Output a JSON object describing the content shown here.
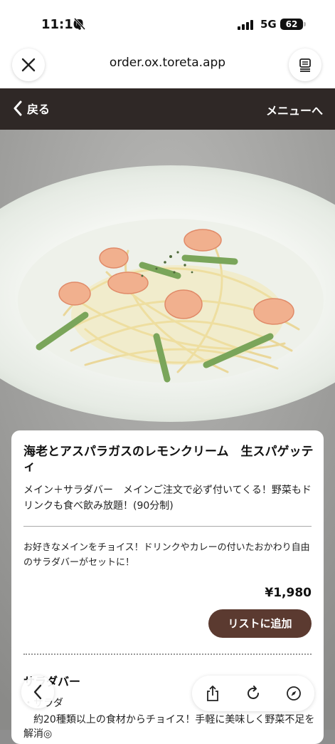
{
  "status_bar": {
    "time": "11:10",
    "network": "5G",
    "battery": "62"
  },
  "browser": {
    "url": "order.ox.toreta.app"
  },
  "nav": {
    "back_label": "戻る",
    "menu_link": "メニューへ"
  },
  "item": {
    "title": "海老とアスパラガスのレモンクリーム　生スパゲッティ",
    "description": "メイン＋サラダバー　メインご注文で必ず付いてくる！野菜もドリンクも食べ飲み放題！(90分制)",
    "details": "お好きなメインをチョイス！ドリンクやカレーの付いたおかわり自由のサラダバーがセットに！",
    "price": "¥1,980",
    "add_button": "リストに追加"
  },
  "section": {
    "title": "サラダバー",
    "sub_label": "・サラダ",
    "sub_desc": "　約20種類以上の食材からチョイス！手軽に美味しく野菜不足を解消◎"
  },
  "colors": {
    "nav_bg": "#2f2826",
    "add_button_bg": "#5b3a30"
  },
  "icons": [
    "bell-slash-icon",
    "signal-icon",
    "close-icon",
    "reader-icon",
    "chevron-left-icon",
    "share-icon",
    "reload-icon",
    "compass-icon"
  ]
}
